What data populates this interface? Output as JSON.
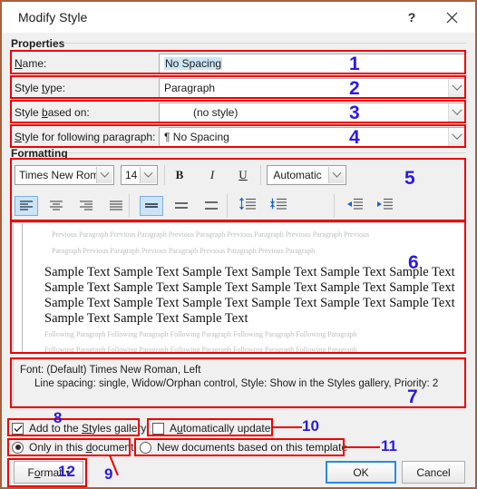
{
  "window": {
    "title": "Modify Style",
    "help_icon": "question-mark-icon",
    "close_icon": "close-icon",
    "border_color": "#a9603d"
  },
  "properties": {
    "group_label": "Properties",
    "rows": [
      {
        "label_pre": "N",
        "label_accel": "a",
        "label_post": "me:",
        "label_full": "Name:",
        "value": "No Spacing",
        "has_dropdown": false,
        "selected": true
      },
      {
        "label_pre": "Style ",
        "label_accel": "t",
        "label_post": "ype:",
        "label_full": "Style type:",
        "value": "Paragraph",
        "has_dropdown": true,
        "selected": false
      },
      {
        "label_pre": "Style ",
        "label_accel": "b",
        "label_post": "ased on:",
        "label_full": "Style based on:",
        "value": "(no style)",
        "has_dropdown": true,
        "selected": false,
        "indent": true
      },
      {
        "label_pre": "",
        "label_accel": "S",
        "label_post": "tyle for following paragraph:",
        "label_full": "Style for following paragraph:",
        "value": "¶ No Spacing",
        "has_dropdown": true,
        "selected": false
      }
    ]
  },
  "formatting": {
    "group_label": "Formatting",
    "font_family": "Times New Roman",
    "font_size": "14",
    "bold_label": "B",
    "italic_label": "I",
    "underline_label": "U",
    "font_color": "Automatic",
    "align_buttons": [
      {
        "name": "align-left-icon",
        "active": true
      },
      {
        "name": "align-center-icon",
        "active": false
      },
      {
        "name": "align-right-icon",
        "active": false
      },
      {
        "name": "align-justify-icon",
        "active": false
      }
    ],
    "spacing_buttons": [
      {
        "name": "line-spacing-single-icon",
        "active": true
      },
      {
        "name": "line-spacing-1-5-icon",
        "active": false
      },
      {
        "name": "line-spacing-double-icon",
        "active": false
      }
    ],
    "paragraph_space_buttons": [
      {
        "name": "space-before-paragraph-icon",
        "active": false
      },
      {
        "name": "space-after-paragraph-icon",
        "active": false
      }
    ],
    "indent_buttons": [
      {
        "name": "decrease-indent-icon",
        "active": false
      },
      {
        "name": "increase-indent-icon",
        "active": false
      }
    ]
  },
  "preview": {
    "previous_line_1": "Previous Paragraph Previous Paragraph Previous Paragraph Previous Paragraph Previous Paragraph Previous",
    "previous_line_2": "Paragraph Previous Paragraph Previous Paragraph Previous Paragraph Previous Paragraph",
    "sample_line_1": "Sample Text Sample Text Sample Text Sample Text Sample Text Sample Text",
    "sample_line_2": "Sample Text Sample Text Sample Text Sample Text Sample Text Sample Text",
    "sample_line_3": "Sample Text Sample Text Sample Text Sample Text Sample Text Sample Text",
    "sample_line_4": "Sample Text Sample Text Sample Text",
    "following_line_1": "Following Paragraph Following Paragraph Following Paragraph Following Paragraph Following Paragraph",
    "following_line_2": "Following Paragraph Following Paragraph Following Paragraph Following Paragraph Following Paragraph"
  },
  "description": {
    "line_1": "Font: (Default) Times New Roman, Left",
    "line_2": "Line spacing:  single, Widow/Orphan control, Style: Show in the Styles gallery, Priority: 2"
  },
  "options": {
    "add_to_gallery": {
      "label_pre": "Add to the ",
      "label_accel": "St",
      "label_post": "yles gallery",
      "label_full": "Add to the Styles gallery",
      "checked": true
    },
    "auto_update": {
      "label_pre": "A",
      "label_accel": "u",
      "label_post": "tomatically update",
      "label_full": "Automatically update",
      "checked": false
    },
    "only_this_document": {
      "label_pre": "Only in this ",
      "label_accel": "d",
      "label_post": "ocument",
      "label_full": "Only in this document",
      "selected": true
    },
    "new_documents": {
      "label_pre": "",
      "label_accel": "",
      "label_post": "New documents based on this template",
      "label_full": "New documents based on this template",
      "selected": false
    }
  },
  "buttons": {
    "format": {
      "label_pre": "F",
      "label_accel": "o",
      "label_post": "rmat",
      "label_full": "Format",
      "caret": "▾"
    },
    "ok": "OK",
    "cancel": "Cancel"
  },
  "annotations": {
    "color_box": "#ef0000",
    "color_num": "#2b1ae0",
    "items": [
      {
        "num": "1",
        "target": "name-field-row"
      },
      {
        "num": "2",
        "target": "style-type-row"
      },
      {
        "num": "3",
        "target": "style-based-on-row"
      },
      {
        "num": "4",
        "target": "style-following-paragraph-row"
      },
      {
        "num": "5",
        "target": "formatting-toolbar"
      },
      {
        "num": "6",
        "target": "style-preview"
      },
      {
        "num": "7",
        "target": "style-description"
      },
      {
        "num": "8",
        "target": "add-to-gallery-checkbox"
      },
      {
        "num": "9",
        "target": "only-this-document-radio"
      },
      {
        "num": "10",
        "target": "automatically-update-checkbox"
      },
      {
        "num": "11",
        "target": "new-documents-radio"
      },
      {
        "num": "12",
        "target": "format-button"
      }
    ]
  }
}
